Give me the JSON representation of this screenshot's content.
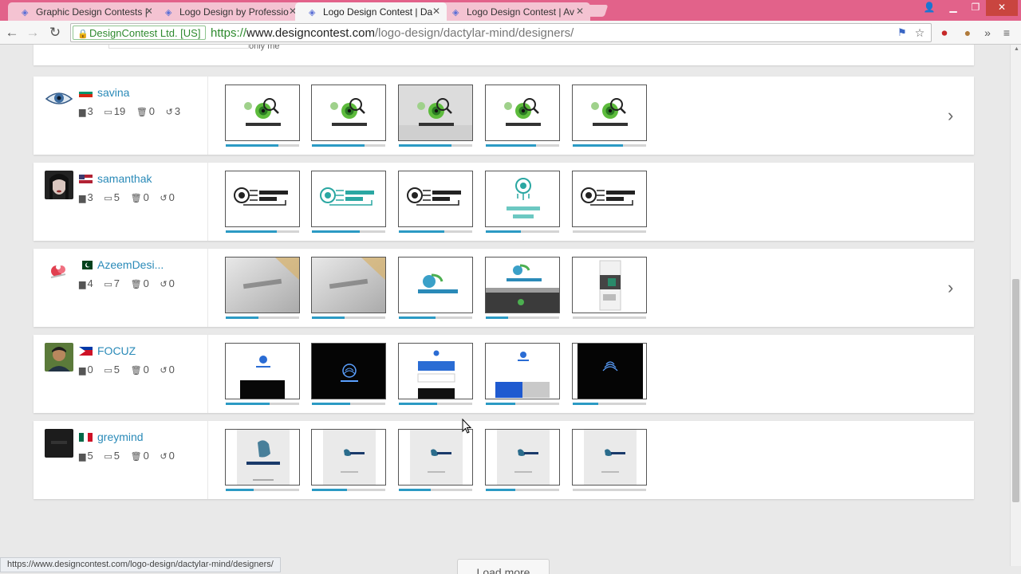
{
  "browser": {
    "tabs": [
      {
        "title": "Graphic Design Contests |",
        "active": false
      },
      {
        "title": "Logo Design by Professio",
        "active": false
      },
      {
        "title": "Logo Design Contest | Da",
        "active": true
      },
      {
        "title": "Logo Design Contest | Av",
        "active": false
      }
    ],
    "ev_badge": "DesignContest Ltd. [US]",
    "url_scheme": "https://",
    "url_host": "www.designcontest.com",
    "url_path": "/logo-design/dactylar-mind/designers/",
    "status_url": "https://www.designcontest.com/logo-design/dactylar-mind/designers/"
  },
  "partial_text": "only me",
  "designers": [
    {
      "name": "savina",
      "flag": {
        "stripes": [
          "#ffffff",
          "#00966e",
          "#d62612"
        ]
      },
      "avatar": "eye",
      "comments": "3",
      "entries": "19",
      "deleted": "0",
      "withdrawn": "3",
      "has_more": true,
      "thumbs": [
        {
          "style": "green-eye",
          "caption": "DACTYLAR MIND",
          "progress": 0.72
        },
        {
          "style": "green-eye",
          "caption": "DACTYLAR MIND",
          "progress": 0.72
        },
        {
          "style": "green-eye-gray",
          "caption": "DACTYLAR MIND",
          "progress": 0.72
        },
        {
          "style": "green-eye",
          "caption": "DACTYLAR MIND",
          "progress": 0.68
        },
        {
          "style": "green-eye",
          "caption": "DACTYLAR MIND",
          "progress": 0.68
        }
      ]
    },
    {
      "name": "samanthak",
      "flag": {
        "stripes": [
          "#b22234",
          "#ffffff",
          "#b22234"
        ],
        "canton": "#3c3b6e"
      },
      "avatar": "woman",
      "comments": "3",
      "entries": "5",
      "deleted": "0",
      "withdrawn": "0",
      "has_more": false,
      "thumbs": [
        {
          "style": "circuit",
          "caption": "DACTYLAR MIND",
          "progress": 0.7
        },
        {
          "style": "circuit-teal",
          "caption": "DACTYLAR MIND",
          "progress": 0.65
        },
        {
          "style": "circuit",
          "caption": "DACTYLAR MIND",
          "progress": 0.62
        },
        {
          "style": "circuit-vertical",
          "caption": "DACTYLAR MIND",
          "progress": 0.48
        },
        {
          "style": "circuit",
          "caption": "DACTYLAR MIND",
          "progress": 0.0
        }
      ]
    },
    {
      "name": "AzeemDesi...",
      "flag": {
        "stripes": [
          "#01411c",
          "#01411c",
          "#01411c"
        ],
        "hoist": "#ffffff"
      },
      "avatar": "flower",
      "comments": "4",
      "entries": "7",
      "deleted": "0",
      "withdrawn": "0",
      "has_more": true,
      "thumbs": [
        {
          "style": "mockup",
          "caption": "DactylarMind",
          "progress": 0.45
        },
        {
          "style": "mockup",
          "caption": "DactylarMind",
          "progress": 0.45
        },
        {
          "style": "flat-logo",
          "caption": "DactylarMind",
          "progress": 0.5
        },
        {
          "style": "flat-logo-dark",
          "caption": "DactylarMind",
          "progress": 0.3
        },
        {
          "style": "stationery",
          "caption": "",
          "progress": 0.0
        }
      ]
    },
    {
      "name": "FOCUZ",
      "flag": {
        "stripes": [
          "#0038a8",
          "#ce1126",
          "#ce1126"
        ],
        "triangle": "#ffffff"
      },
      "avatar": "man",
      "comments": "0",
      "entries": "5",
      "deleted": "0",
      "withdrawn": "0",
      "has_more": false,
      "thumbs": [
        {
          "style": "blue-white",
          "caption": "",
          "progress": 0.6
        },
        {
          "style": "blue-black",
          "caption": "",
          "progress": 0.52
        },
        {
          "style": "blue-cards",
          "caption": "",
          "progress": 0.52
        },
        {
          "style": "blue-banner",
          "caption": "",
          "progress": 0.4
        },
        {
          "style": "blue-black-2",
          "caption": "",
          "progress": 0.35
        }
      ]
    },
    {
      "name": "greymind",
      "flag": {
        "stripes": [
          "#006847",
          "#ffffff",
          "#ce1126"
        ],
        "vertical": true
      },
      "avatar": "dark",
      "comments": "5",
      "entries": "5",
      "deleted": "0",
      "withdrawn": "0",
      "has_more": false,
      "thumbs": [
        {
          "style": "hand",
          "caption": "DACTYLAR MIND",
          "progress": 0.38
        },
        {
          "style": "hand-small",
          "caption": "",
          "progress": 0.48
        },
        {
          "style": "hand-small",
          "caption": "",
          "progress": 0.44
        },
        {
          "style": "hand-small",
          "caption": "",
          "progress": 0.4
        },
        {
          "style": "hand-small",
          "caption": "",
          "progress": 0.0
        }
      ]
    }
  ],
  "load_more_label": "Load more",
  "colors": {
    "accent": "#2a8ab8",
    "progress": "#2b9ac4",
    "tabbar": "#e2628a"
  }
}
